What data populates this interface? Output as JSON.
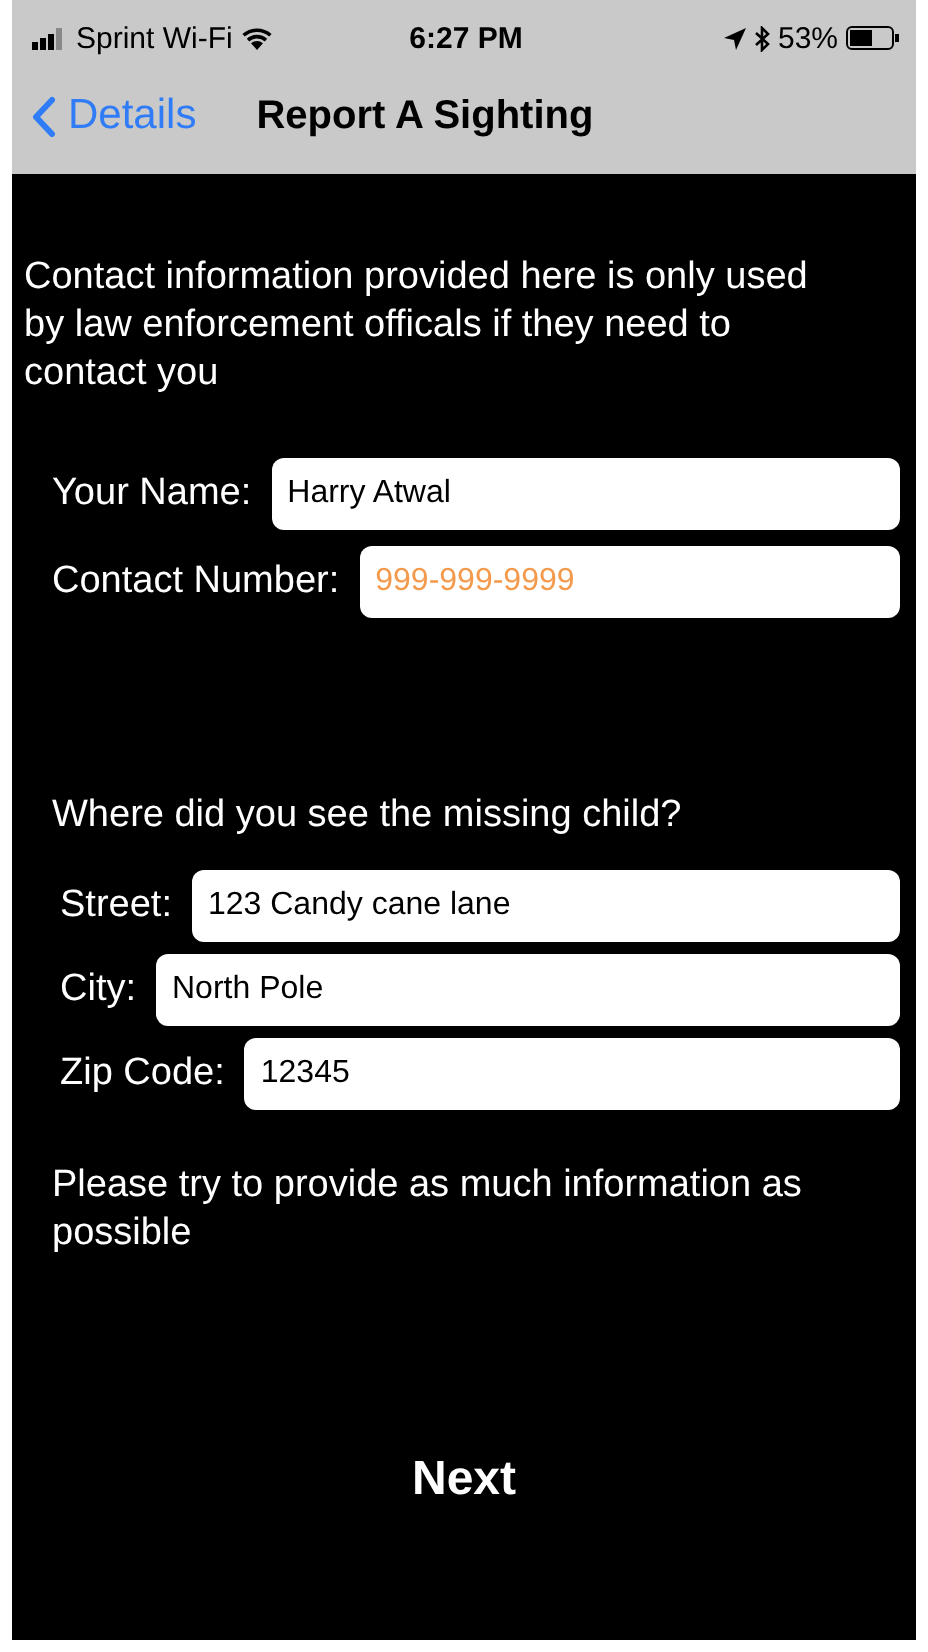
{
  "status_bar": {
    "carrier": "Sprint Wi-Fi",
    "time": "6:27 PM",
    "battery": "53%"
  },
  "nav": {
    "back": "Details",
    "title": "Report A Sighting"
  },
  "intro": "Contact information provided here is only used by law enforcement officals if they need to contact you",
  "contact_fields": [
    {
      "label": "Your Name:",
      "value": "Harry Atwal"
    },
    {
      "label": "Contact Number:",
      "placeholder": "999-999-9999"
    }
  ],
  "location_heading": "Where did you see the missing child?",
  "location_fields": [
    {
      "label": "Street:",
      "value": "123 Candy cane lane"
    },
    {
      "label": "City:",
      "value": "North Pole"
    },
    {
      "label": "Zip Code:",
      "value": "12345"
    }
  ],
  "note": "Please try to provide as much information as possible",
  "next_button": "Next"
}
